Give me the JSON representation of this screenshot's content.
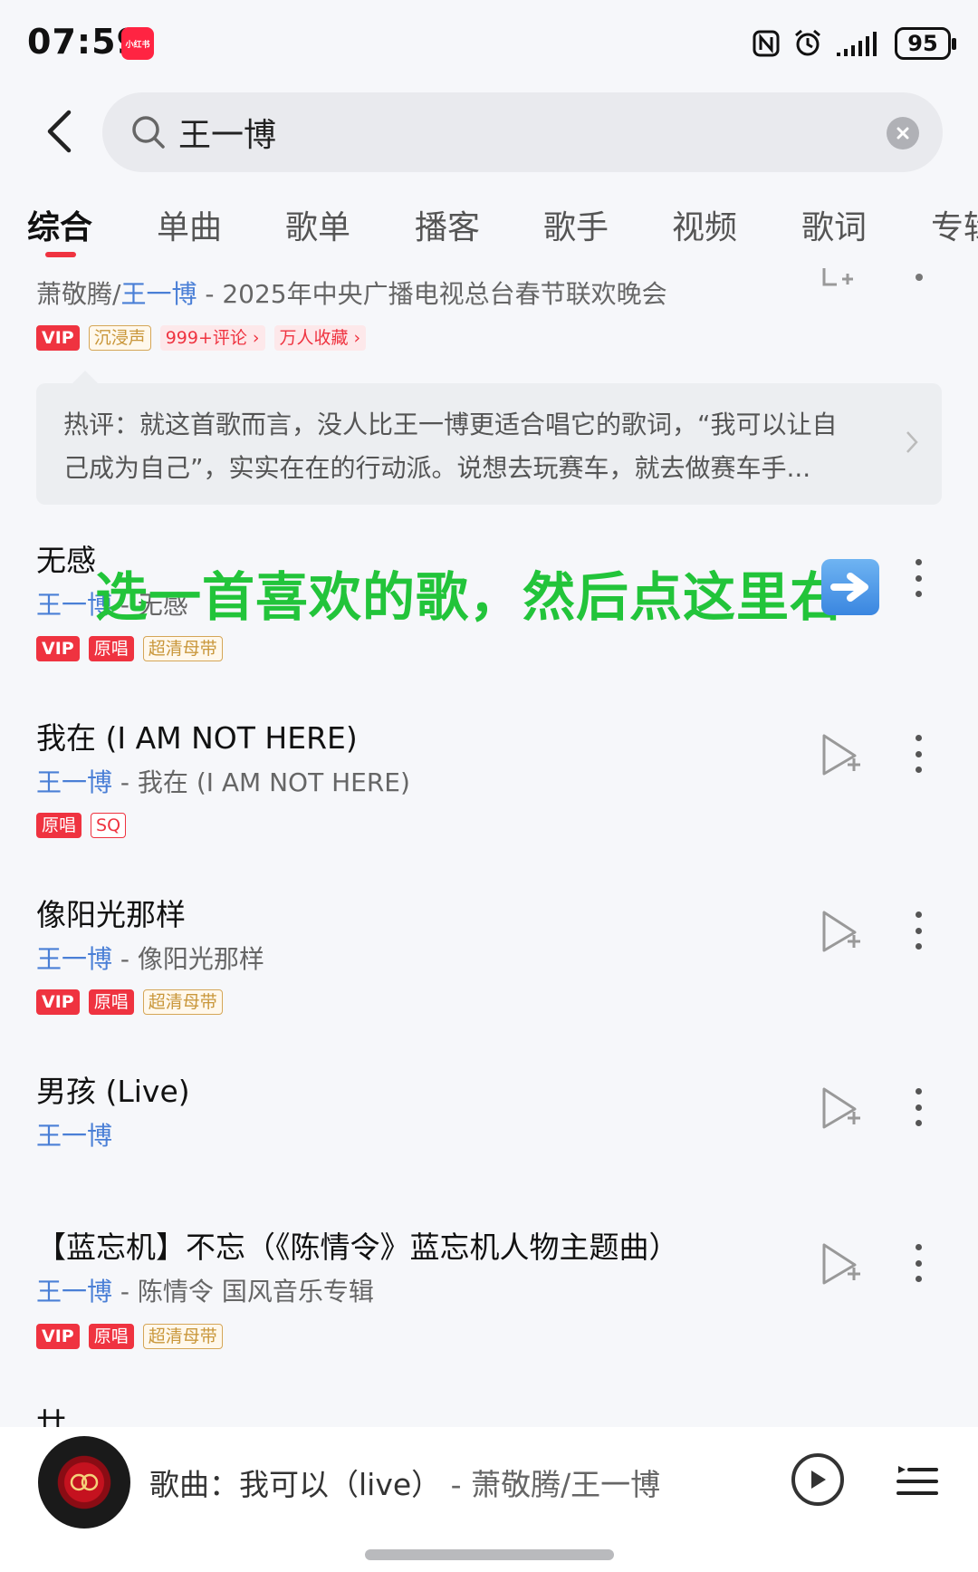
{
  "status_bar": {
    "time": "07:59",
    "app_badge": "小红书",
    "battery": "95",
    "icons": [
      "nfc-icon",
      "alarm-icon",
      "signal-icon",
      "battery-icon"
    ]
  },
  "search": {
    "query": "王一博"
  },
  "tabs": [
    {
      "label": "综合",
      "active": true
    },
    {
      "label": "单曲"
    },
    {
      "label": "歌单"
    },
    {
      "label": "播客"
    },
    {
      "label": "歌手"
    },
    {
      "label": "视频"
    },
    {
      "label": "歌词"
    },
    {
      "label": "专辑"
    }
  ],
  "top_song": {
    "artists": "萧敬腾/",
    "artist_highlight": "王一博",
    "album": " - 2025年中央广播电视总台春节联欢晚会",
    "tags": [
      "VIP",
      "沉浸声",
      "999+评论",
      "万人收藏"
    ]
  },
  "hot_comment": {
    "line1": "热评：就这首歌而言，没人比王一博更适合唱它的歌词，“我可以让自",
    "line2": "己成为自己”，实实在在的行动派。说想去玩赛车，就去做赛车手..."
  },
  "overlay": {
    "text": "选一首喜欢的歌，然后点这里右"
  },
  "songs": [
    {
      "title": "无感",
      "artist": "王一博",
      "album": " - 无感",
      "tags": [
        "VIP",
        "原唱",
        "超清母带"
      ]
    },
    {
      "title": "我在 (I AM NOT HERE)",
      "artist": "王一博",
      "album": " - 我在 (I AM NOT HERE)",
      "tags": [
        "原唱",
        "SQ"
      ]
    },
    {
      "title": "像阳光那样",
      "artist": "王一博",
      "album": " - 像阳光那样",
      "tags": [
        "VIP",
        "原唱",
        "超清母带"
      ]
    },
    {
      "title": "男孩 (Live)",
      "artist": "王一博",
      "album": "",
      "tags": []
    },
    {
      "title": "【蓝忘机】不忘（《陈情令》蓝忘机人物主题曲）",
      "artist": "王一博",
      "album": " - 陈情令 国风音乐专辑",
      "tags": [
        "VIP",
        "原唱",
        "超清母带"
      ]
    },
    {
      "title": "廿",
      "artist": "",
      "album": "",
      "tags": []
    }
  ],
  "player": {
    "prefix": "歌曲：",
    "song": "我可以（live）",
    "separator": " - ",
    "artist": "萧敬腾/王一博"
  },
  "colors": {
    "accent": "#ef3340",
    "artist_blue": "#4a7fd6",
    "overlay_green": "#22c43a",
    "background": "#f6f7fa"
  }
}
